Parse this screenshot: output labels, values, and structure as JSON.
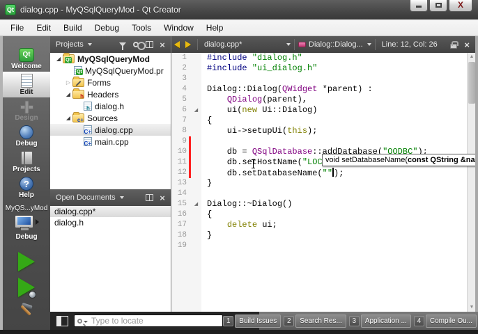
{
  "window": {
    "title": "dialog.cpp - MyQSqlQueryMod - Qt Creator",
    "app_icon_text": "Qt"
  },
  "menu": {
    "items": [
      "File",
      "Edit",
      "Build",
      "Debug",
      "Tools",
      "Window",
      "Help"
    ]
  },
  "sidebar": {
    "modes": [
      {
        "id": "welcome",
        "label": "Welcome",
        "selected": false,
        "disabled": false
      },
      {
        "id": "edit",
        "label": "Edit",
        "selected": true,
        "disabled": false
      },
      {
        "id": "design",
        "label": "Design",
        "selected": false,
        "disabled": true
      },
      {
        "id": "debug",
        "label": "Debug",
        "selected": false,
        "disabled": false
      },
      {
        "id": "projects",
        "label": "Projects",
        "selected": false,
        "disabled": false
      },
      {
        "id": "help",
        "label": "Help",
        "selected": false,
        "disabled": false
      }
    ],
    "target": {
      "project": "MyQS...yMod",
      "config": "Debug"
    }
  },
  "projects_panel": {
    "title": "Projects",
    "tree": [
      {
        "label": "MyQSqlQueryMod",
        "depth": 0,
        "expander": "open",
        "icon": "qt-folder",
        "bold": true,
        "selected": false
      },
      {
        "label": "MyQSqlQueryMod.pr",
        "depth": 1,
        "expander": null,
        "icon": "pro-file",
        "bold": false,
        "selected": false
      },
      {
        "label": "Forms",
        "depth": 1,
        "expander": "closed",
        "icon": "forms-folder",
        "bold": false,
        "selected": false
      },
      {
        "label": "Headers",
        "depth": 1,
        "expander": "open",
        "icon": "headers-folder",
        "bold": false,
        "selected": false
      },
      {
        "label": "dialog.h",
        "depth": 2,
        "expander": null,
        "icon": "h-file",
        "bold": false,
        "selected": false
      },
      {
        "label": "Sources",
        "depth": 1,
        "expander": "open",
        "icon": "sources-folder",
        "bold": false,
        "selected": false
      },
      {
        "label": "dialog.cpp",
        "depth": 2,
        "expander": null,
        "icon": "cpp-file",
        "bold": false,
        "selected": true
      },
      {
        "label": "main.cpp",
        "depth": 2,
        "expander": null,
        "icon": "cpp-file",
        "bold": false,
        "selected": false
      }
    ]
  },
  "open_documents": {
    "title": "Open Documents",
    "items": [
      {
        "label": "dialog.cpp*",
        "selected": true
      },
      {
        "label": "dialog.h",
        "selected": false
      }
    ]
  },
  "editor": {
    "file_label": "dialog.cpp*",
    "symbol_label": "Dialog::Dialog...",
    "position_label": "Line: 12, Col: 26",
    "tooltip": {
      "prefix": "void setDatabaseName(",
      "bold": "const QString &nam"
    },
    "colors": {
      "pp": "#000080",
      "str": "#008000",
      "typ": "#800080",
      "kw": "#808000",
      "pl": "#000000"
    },
    "lines": [
      {
        "n": 1,
        "fold": false,
        "chg": false,
        "seg": [
          [
            "pp",
            "#include "
          ],
          [
            "str",
            "\"dialog.h\""
          ]
        ]
      },
      {
        "n": 2,
        "fold": false,
        "chg": false,
        "seg": [
          [
            "pp",
            "#include "
          ],
          [
            "str",
            "\"ui_dialog.h\""
          ]
        ]
      },
      {
        "n": 3,
        "fold": false,
        "chg": false,
        "seg": []
      },
      {
        "n": 4,
        "fold": false,
        "chg": false,
        "seg": [
          [
            "pl",
            "Dialog::Dialog("
          ],
          [
            "typ",
            "QWidget"
          ],
          [
            "pl",
            " *parent) :"
          ]
        ]
      },
      {
        "n": 5,
        "fold": false,
        "chg": false,
        "seg": [
          [
            "pl",
            "    "
          ],
          [
            "typ",
            "QDialog"
          ],
          [
            "pl",
            "(parent),"
          ]
        ]
      },
      {
        "n": 6,
        "fold": true,
        "chg": false,
        "seg": [
          [
            "pl",
            "    ui("
          ],
          [
            "kw",
            "new"
          ],
          [
            "pl",
            " Ui::Dialog)"
          ]
        ]
      },
      {
        "n": 7,
        "fold": false,
        "chg": false,
        "seg": [
          [
            "pl",
            "{"
          ]
        ]
      },
      {
        "n": 8,
        "fold": false,
        "chg": false,
        "seg": [
          [
            "pl",
            "    ui->setupUi("
          ],
          [
            "kw",
            "this"
          ],
          [
            "pl",
            ");"
          ]
        ]
      },
      {
        "n": 9,
        "fold": false,
        "chg": true,
        "seg": []
      },
      {
        "n": 10,
        "fold": false,
        "chg": true,
        "seg": [
          [
            "pl",
            "    db = "
          ],
          [
            "typ",
            "QSqlDatabase"
          ],
          [
            "pl",
            "::addDatabase("
          ],
          [
            "str",
            "\"QODBC\""
          ],
          [
            "pl",
            ");"
          ]
        ]
      },
      {
        "n": 11,
        "fold": false,
        "chg": true,
        "seg": [
          [
            "pl",
            "    db.setHostName("
          ],
          [
            "str",
            "\"LOC"
          ]
        ]
      },
      {
        "n": 12,
        "fold": false,
        "chg": true,
        "seg": [
          [
            "pl",
            "    db.setDatabaseName("
          ],
          [
            "str",
            "\"\""
          ],
          [
            "caret",
            ""
          ],
          [
            "pl",
            ");"
          ]
        ]
      },
      {
        "n": 13,
        "fold": false,
        "chg": false,
        "seg": [
          [
            "pl",
            "}"
          ]
        ]
      },
      {
        "n": 14,
        "fold": false,
        "chg": false,
        "seg": []
      },
      {
        "n": 15,
        "fold": true,
        "chg": false,
        "seg": [
          [
            "pl",
            "Dialog::~Dialog()"
          ]
        ]
      },
      {
        "n": 16,
        "fold": false,
        "chg": false,
        "seg": [
          [
            "pl",
            "{"
          ]
        ]
      },
      {
        "n": 17,
        "fold": false,
        "chg": false,
        "seg": [
          [
            "pl",
            "    "
          ],
          [
            "kw",
            "delete"
          ],
          [
            "pl",
            " ui;"
          ]
        ]
      },
      {
        "n": 18,
        "fold": false,
        "chg": false,
        "seg": [
          [
            "pl",
            "}"
          ]
        ]
      },
      {
        "n": 19,
        "fold": false,
        "chg": false,
        "seg": []
      }
    ]
  },
  "statusbar": {
    "locator_placeholder": "Type to locate",
    "panes": [
      {
        "num": "1",
        "label": "Build Issues"
      },
      {
        "num": "2",
        "label": "Search Res..."
      },
      {
        "num": "3",
        "label": "Application ..."
      },
      {
        "num": "4",
        "label": "Compile Ou..."
      }
    ]
  }
}
